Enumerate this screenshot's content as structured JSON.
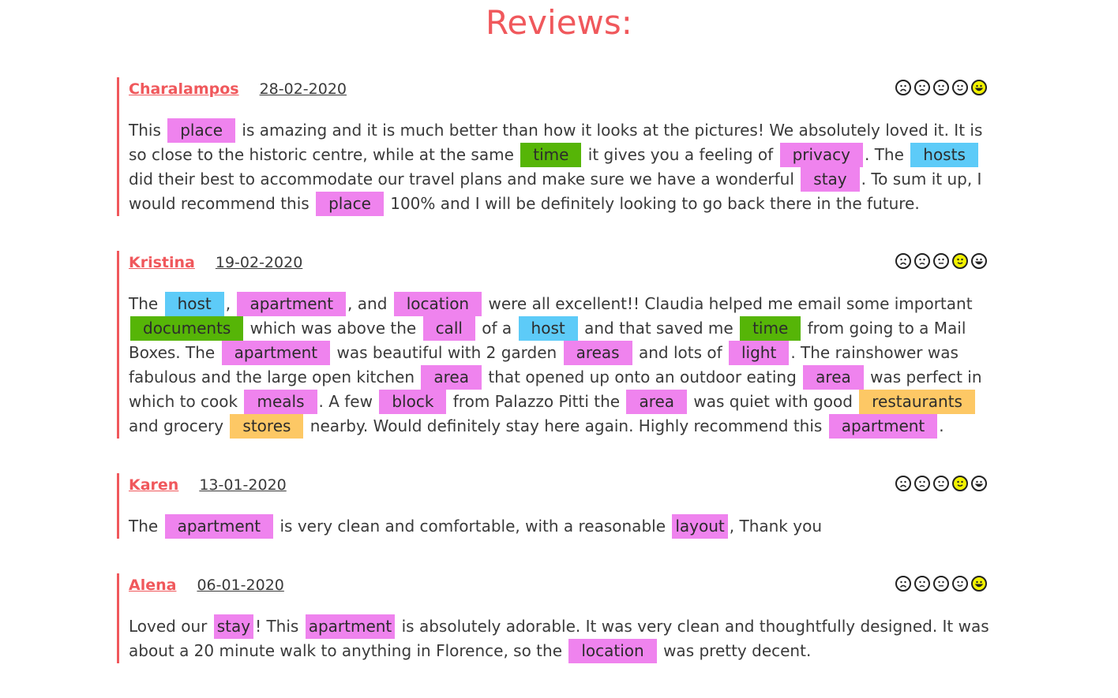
{
  "page": {
    "title": "Reviews:"
  },
  "colors": {
    "accent": "#f0585c",
    "place_tag": "#ef83ee",
    "time_tag": "#56b507",
    "host_tag": "#5dcbf8",
    "food_tag": "#fdc865",
    "selected_rating": "#f2f200"
  },
  "rating_icons": [
    "very-sad-face-icon",
    "sad-face-icon",
    "neutral-face-icon",
    "smile-face-icon",
    "big-smile-face-icon"
  ],
  "reviews": [
    {
      "author": "Charalampos",
      "date": "28-02-2020",
      "rating": 5,
      "body": [
        {
          "t": "This "
        },
        {
          "tag": "place",
          "c": "pink"
        },
        {
          "t": " is amazing and it is much better than how it looks at the pictures! We absolutely loved it. It is so close to the historic centre, while at the same "
        },
        {
          "tag": "time",
          "c": "green"
        },
        {
          "t": " it gives you a feeling of "
        },
        {
          "tag": "privacy",
          "c": "pink"
        },
        {
          "t": ". The "
        },
        {
          "tag": "hosts",
          "c": "blue"
        },
        {
          "t": " did their best to accommodate our travel plans and make sure we have a wonderful "
        },
        {
          "tag": "stay",
          "c": "pink"
        },
        {
          "t": ". To sum it up, I would recommend this "
        },
        {
          "tag": "place",
          "c": "pink"
        },
        {
          "t": " 100% and I will be definitely looking to go back there in the future."
        }
      ]
    },
    {
      "author": "Kristina",
      "date": "19-02-2020",
      "rating": 4,
      "body": [
        {
          "t": "The "
        },
        {
          "tag": "host",
          "c": "blue"
        },
        {
          "t": ", "
        },
        {
          "tag": "apartment",
          "c": "pink"
        },
        {
          "t": ", and "
        },
        {
          "tag": "location",
          "c": "pink"
        },
        {
          "t": " were all excellent!! Claudia helped me email some important "
        },
        {
          "tag": "documents",
          "c": "green"
        },
        {
          "t": " which was above the "
        },
        {
          "tag": "call",
          "c": "pink"
        },
        {
          "t": " of a "
        },
        {
          "tag": "host",
          "c": "blue"
        },
        {
          "t": " and that saved me "
        },
        {
          "tag": "time",
          "c": "green"
        },
        {
          "t": " from going to a Mail Boxes. The "
        },
        {
          "tag": "apartment",
          "c": "pink"
        },
        {
          "t": " was beautiful with 2 garden "
        },
        {
          "tag": "areas",
          "c": "pink"
        },
        {
          "t": " and lots of "
        },
        {
          "tag": "light",
          "c": "pink"
        },
        {
          "t": ". The rainshower was fabulous and the large open kitchen "
        },
        {
          "tag": "area",
          "c": "pink"
        },
        {
          "t": " that opened up onto an outdoor eating "
        },
        {
          "tag": "area",
          "c": "pink"
        },
        {
          "t": " was perfect in which to cook "
        },
        {
          "tag": "meals",
          "c": "pink"
        },
        {
          "t": ". A few "
        },
        {
          "tag": "block",
          "c": "pink"
        },
        {
          "t": " from Palazzo Pitti the "
        },
        {
          "tag": "area",
          "c": "pink"
        },
        {
          "t": " was quiet with good "
        },
        {
          "tag": "restaurants",
          "c": "orange"
        },
        {
          "t": " and grocery "
        },
        {
          "tag": "stores",
          "c": "orange"
        },
        {
          "t": " nearby. Would definitely stay here again. Highly recommend this "
        },
        {
          "tag": "apartment",
          "c": "pink"
        },
        {
          "t": "."
        }
      ]
    },
    {
      "author": "Karen",
      "date": "13-01-2020",
      "rating": 4,
      "body": [
        {
          "t": "The "
        },
        {
          "tag": "apartment",
          "c": "pink"
        },
        {
          "t": " is very clean and comfortable, with a reasonable "
        },
        {
          "tag": "layout",
          "c": "pink",
          "tight": true
        },
        {
          "t": ", Thank you"
        }
      ]
    },
    {
      "author": "Alena",
      "date": "06-01-2020",
      "rating": 5,
      "body": [
        {
          "t": "Loved our "
        },
        {
          "tag": "stay",
          "c": "pink",
          "tight": true
        },
        {
          "t": "! This "
        },
        {
          "tag": "apartment",
          "c": "pink",
          "tight": true
        },
        {
          "t": " is absolutely adorable. It was very clean and thoughtfully designed. It was about a 20 minute walk to anything in Florence, so the "
        },
        {
          "tag": "location",
          "c": "pink"
        },
        {
          "t": " was pretty decent."
        }
      ]
    }
  ]
}
